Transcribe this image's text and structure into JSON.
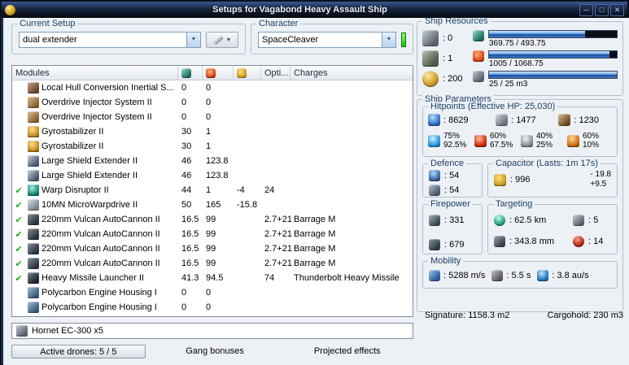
{
  "window": {
    "title": "Setups for Vagabond Heavy Assault Ship",
    "controls": {
      "minimize": "─",
      "maximize": "□",
      "close": "✕"
    }
  },
  "setup_group": {
    "label": "Current Setup",
    "selected": "dual extender"
  },
  "character_group": {
    "label": "Character",
    "selected": "SpaceCleaver"
  },
  "modules_table": {
    "columns": {
      "modules": "Modules",
      "opti": "Opti...",
      "charges": "Charges"
    },
    "rows": [
      {
        "active": false,
        "icon": "inertial-stabilizer-icon",
        "name": "Local Hull Conversion Inertial S...",
        "cpu": "0",
        "pg": "0",
        "cap": "",
        "opti": "",
        "charges": ""
      },
      {
        "active": false,
        "icon": "overdrive-injector-icon",
        "name": "Overdrive Injector System II",
        "cpu": "0",
        "pg": "0",
        "cap": "",
        "opti": "",
        "charges": ""
      },
      {
        "active": false,
        "icon": "overdrive-injector-icon",
        "name": "Overdrive Injector System II",
        "cpu": "0",
        "pg": "0",
        "cap": "",
        "opti": "",
        "charges": ""
      },
      {
        "active": false,
        "icon": "gyrostabilizer-icon",
        "name": "Gyrostabilizer II",
        "cpu": "30",
        "pg": "1",
        "cap": "",
        "opti": "",
        "charges": ""
      },
      {
        "active": false,
        "icon": "gyrostabilizer-icon",
        "name": "Gyrostabilizer II",
        "cpu": "30",
        "pg": "1",
        "cap": "",
        "opti": "",
        "charges": ""
      },
      {
        "active": false,
        "icon": "shield-extender-icon",
        "name": "Large Shield Extender II",
        "cpu": "46",
        "pg": "123.8",
        "cap": "",
        "opti": "",
        "charges": ""
      },
      {
        "active": false,
        "icon": "shield-extender-icon",
        "name": "Large Shield Extender II",
        "cpu": "46",
        "pg": "123.8",
        "cap": "",
        "opti": "",
        "charges": ""
      },
      {
        "active": true,
        "icon": "warp-disruptor-icon",
        "name": "Warp Disruptor II",
        "cpu": "44",
        "pg": "1",
        "cap": "-4",
        "opti": "24",
        "charges": ""
      },
      {
        "active": true,
        "icon": "microwarpdrive-icon",
        "name": "10MN MicroWarpdrive II",
        "cpu": "50",
        "pg": "165",
        "cap": "-15.8",
        "opti": "",
        "charges": ""
      },
      {
        "active": true,
        "icon": "autocannon-icon",
        "name": "220mm Vulcan AutoCannon II",
        "cpu": "16.5",
        "pg": "99",
        "cap": "",
        "opti": "2.7+21",
        "charges": "Barrage M"
      },
      {
        "active": true,
        "icon": "autocannon-icon",
        "name": "220mm Vulcan AutoCannon II",
        "cpu": "16.5",
        "pg": "99",
        "cap": "",
        "opti": "2.7+21",
        "charges": "Barrage M"
      },
      {
        "active": true,
        "icon": "autocannon-icon",
        "name": "220mm Vulcan AutoCannon II",
        "cpu": "16.5",
        "pg": "99",
        "cap": "",
        "opti": "2.7+21",
        "charges": "Barrage M"
      },
      {
        "active": true,
        "icon": "autocannon-icon",
        "name": "220mm Vulcan AutoCannon II",
        "cpu": "16.5",
        "pg": "99",
        "cap": "",
        "opti": "2.7+21",
        "charges": "Barrage M"
      },
      {
        "active": true,
        "icon": "missile-launcher-icon",
        "name": "Heavy Missile Launcher II",
        "cpu": "41.3",
        "pg": "94.5",
        "cap": "",
        "opti": "74",
        "charges": "Thunderbolt Heavy Missile"
      },
      {
        "active": false,
        "icon": "polycarbon-icon",
        "name": "Polycarbon Engine Housing I",
        "cpu": "0",
        "pg": "0",
        "cap": "",
        "opti": "",
        "charges": ""
      },
      {
        "active": false,
        "icon": "polycarbon-icon",
        "name": "Polycarbon Engine Housing I",
        "cpu": "0",
        "pg": "0",
        "cap": "",
        "opti": "",
        "charges": ""
      }
    ]
  },
  "drone_bay": {
    "row_label": "Hornet EC-300 x5"
  },
  "bottom_bar": {
    "active_drones": "Active drones: 5 / 5",
    "gang_bonuses": "Gang bonuses",
    "projected_effects": "Projected effects"
  },
  "ship_resources": {
    "title": "Ship Resources",
    "turrets": ": 0",
    "launchers": ": 1",
    "calibration": ": 200",
    "cpu": {
      "label": "369.75 / 493.75",
      "percent": 75
    },
    "powergrid": {
      "label": "1005 / 1068.75",
      "percent": 94
    },
    "dronebay": {
      "label": "25 / 25 m3",
      "percent": 100
    }
  },
  "ship_parameters": {
    "title": "Ship Parameters",
    "hitpoints": {
      "title": "Hitpoints (Effective HP: 25,030)",
      "shield": ": 8629",
      "armor": ": 1477",
      "structure": ": 1230",
      "resists": [
        {
          "icon": "em-resist-icon",
          "shield": "75%",
          "armor": "92.5%"
        },
        {
          "icon": "thermal-resist-icon",
          "shield": "60%",
          "armor": "67.5%"
        },
        {
          "icon": "kinetic-resist-icon",
          "shield": "40%",
          "armor": "25%"
        },
        {
          "icon": "explosive-resist-icon",
          "shield": "60%",
          "armor": "10%"
        }
      ]
    },
    "defence": {
      "title": "Defence",
      "value1": ": 54",
      "value2": ": 54"
    },
    "capacitor": {
      "title": "Capacitor (Lasts: 1m 17s)",
      "capacity": ": 996",
      "drain": "- 19.8",
      "recharge": "+9.5"
    },
    "firepower": {
      "title": "Firepower",
      "dps": ": 331",
      "volley": ": 679"
    },
    "targeting": {
      "title": "Targeting",
      "range": ": 62.5 km",
      "max_targets": ": 5",
      "scan_resolution": ": 343.8 mm",
      "sensor_strength": ": 14"
    },
    "mobility": {
      "title": "Mobility",
      "speed": ": 5288 m/s",
      "align_time": ": 5.5 s",
      "warp_speed": ": 3.8 au/s"
    },
    "signature": "Signature: 1158.3 m2",
    "cargohold": "Cargohold: 230 m3"
  }
}
